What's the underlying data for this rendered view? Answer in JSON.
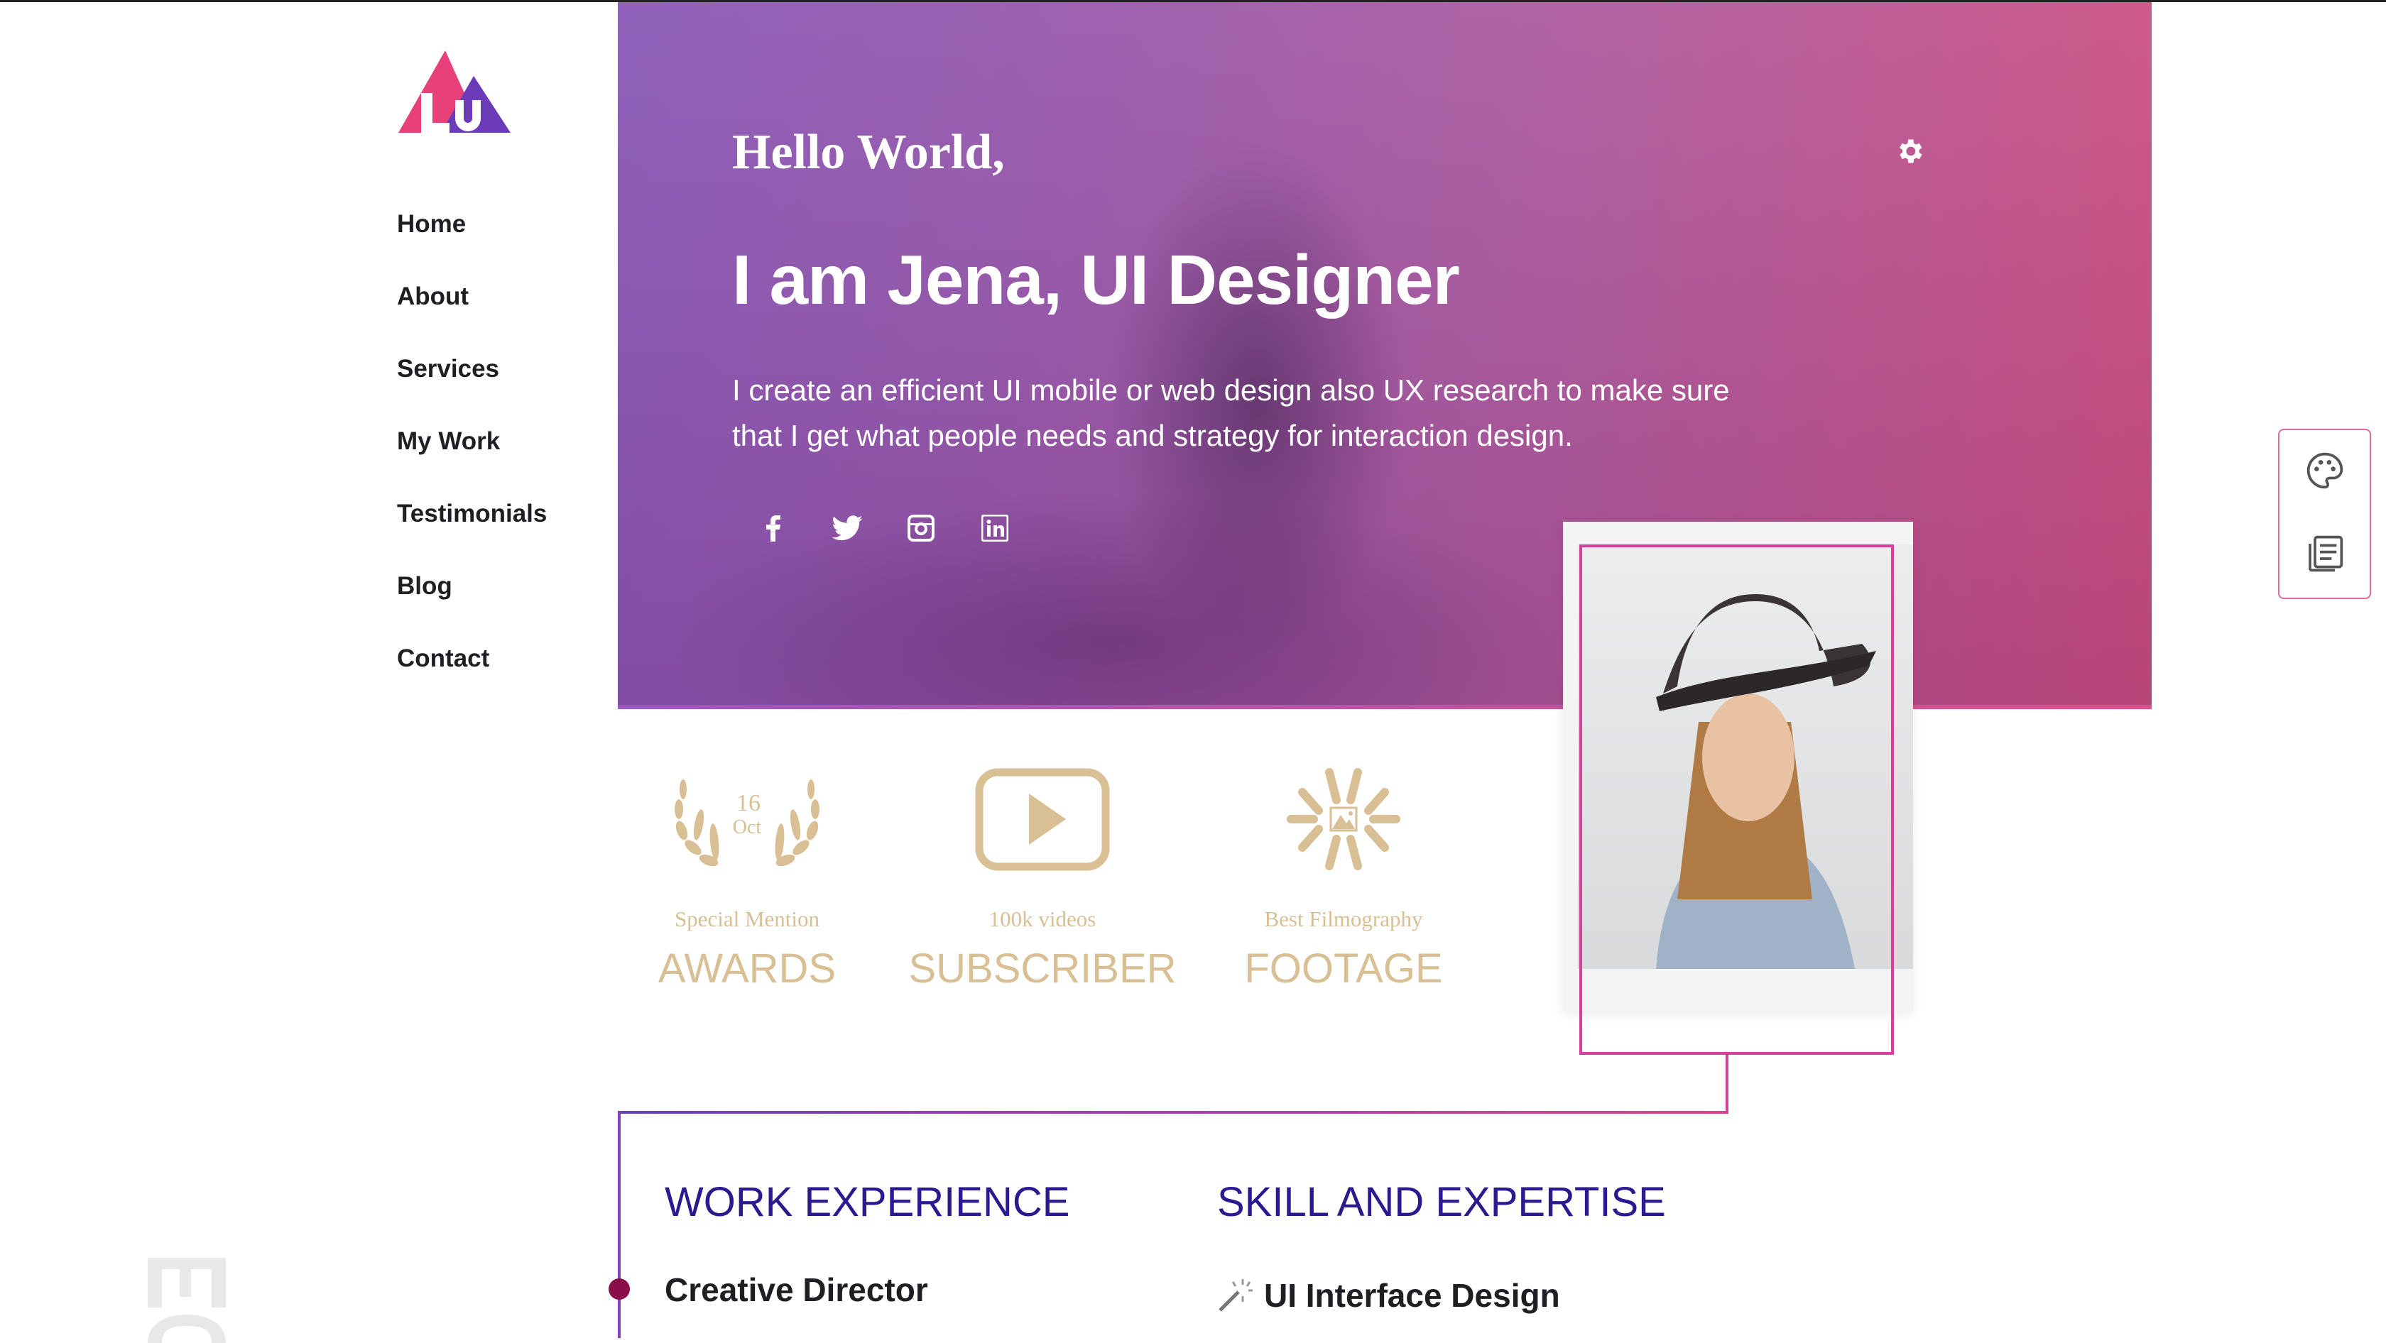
{
  "logo": {
    "letters": "LU",
    "colors": {
      "pink": "#e8417a",
      "purple": "#6b3bb8"
    }
  },
  "nav": {
    "items": [
      {
        "label": "Home"
      },
      {
        "label": "About"
      },
      {
        "label": "Services"
      },
      {
        "label": "My Work"
      },
      {
        "label": "Testimonials"
      },
      {
        "label": "Blog"
      },
      {
        "label": "Contact"
      }
    ]
  },
  "hero": {
    "greeting": "Hello World,",
    "title": "I am Jena, UI Designer",
    "description": "I create an efficient UI mobile or web design also UX research to make sure that I get what people needs and strategy for interaction design.",
    "social": [
      "facebook-icon",
      "twitter-icon",
      "instagram-icon",
      "linkedin-icon"
    ],
    "settings_icon": "gear-icon"
  },
  "stats": [
    {
      "icon": "laurel-icon",
      "icon_day": "16",
      "icon_month": "Oct",
      "small": "Special Mention",
      "big": "AWARDS"
    },
    {
      "icon": "play-icon",
      "small": "100k videos",
      "big": "SUBSCRIBER"
    },
    {
      "icon": "burst-image-icon",
      "small": "Best Filmography",
      "big": "FOOTAGE"
    }
  ],
  "sections": {
    "work": {
      "heading": "WORK EXPERIENCE",
      "items": [
        {
          "title": "Creative Director"
        }
      ]
    },
    "skills": {
      "heading": "SKILL AND EXPERTISE",
      "items": [
        {
          "title": "UI Interface Design",
          "icon": "magic-wand-icon"
        }
      ]
    }
  },
  "side_panel": {
    "icons": [
      "palette-icon",
      "document-icon"
    ]
  },
  "colors": {
    "accent_gold": "#d8bf94",
    "heading_blue": "#2a1a8f",
    "pink": "#d4409a"
  }
}
